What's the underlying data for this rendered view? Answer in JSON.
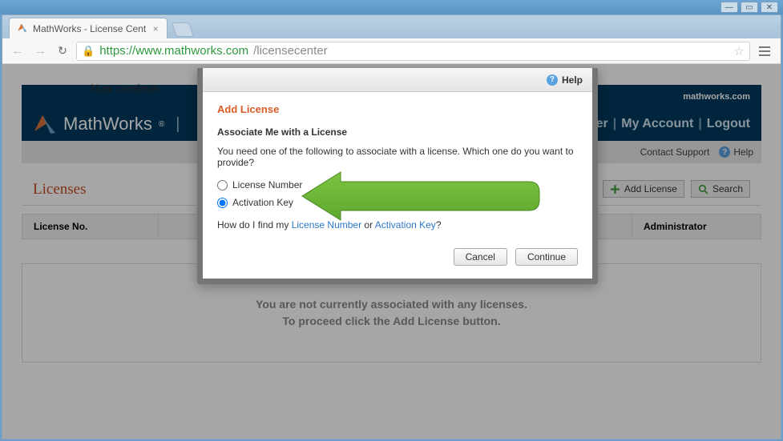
{
  "window": {
    "tab_title": "MathWorks - License Cent",
    "url_host": "https://www.mathworks.com",
    "url_path": "/licensecenter"
  },
  "header": {
    "brand": "MathWorks",
    "site_link": "mathworks.com",
    "user": "Vurlicer",
    "my_account": "My Account",
    "logout": "Logout"
  },
  "subbar": {
    "contact": "Contact Support",
    "help": "Help"
  },
  "licenses": {
    "title": "Licenses",
    "add_btn": "Add License",
    "search_btn": "Search",
    "col_license_no": "License No.",
    "col_admin": "Administrator",
    "empty_l1": "You are not currently associated with any licenses.",
    "empty_l2": "To proceed click the Add License button."
  },
  "modal": {
    "help": "Help",
    "heading": "Add License",
    "subheading": "Associate Me with a License",
    "instruction": "You need one of the following to associate with a license. Which one do you want to provide?",
    "opt_license_number": "License Number",
    "opt_activation_key": "Activation Key",
    "find_prefix": "How do I find my ",
    "find_ln": "License Number",
    "find_or": " or ",
    "find_ak": "Activation Key",
    "find_q": "?",
    "cancel": "Cancel",
    "continue": "Continue"
  },
  "annotation": {
    "text": "Now continue"
  }
}
